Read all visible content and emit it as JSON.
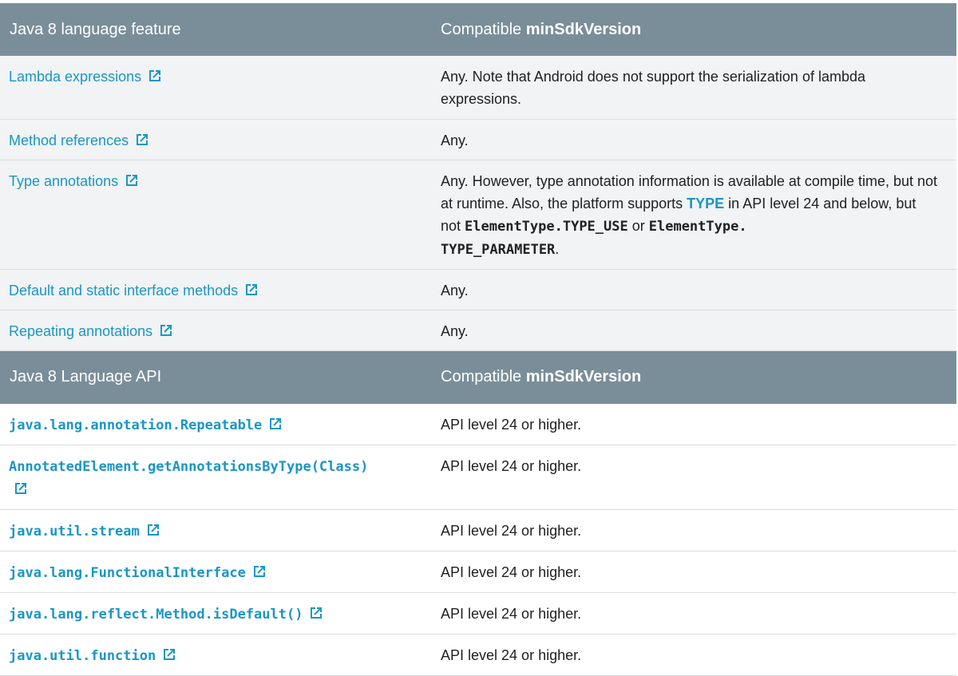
{
  "colors": {
    "header_bg": "#7a8e99",
    "link": "#1a96c4",
    "row_alt_bg": "#f1f3f4",
    "border": "#dadce0"
  },
  "icons": {
    "external_link": "external-link-icon"
  },
  "section1": {
    "header": {
      "col1": "Java 8 language feature",
      "col2_prefix": "Compatible ",
      "col2_bold": "minSdkVersion"
    },
    "rows": [
      {
        "feature": "Lambda expressions",
        "compat": "Any. Note that Android does not support the serialization of lambda expressions."
      },
      {
        "feature": "Method references",
        "compat": "Any."
      },
      {
        "feature": "Type annotations",
        "compat_parts": {
          "p1": "Any. However, type annotation information is available at compile time, but not at runtime. Also, the platform supports ",
          "kw": "TYPE",
          "p2": " in API level 24 and below, but not ",
          "code1": "ElementType.TYPE_USE",
          "p3": " or ",
          "code2a": "ElementType.",
          "code2b": "TYPE_PARAMETER",
          "p4": "."
        }
      },
      {
        "feature": "Default and static interface methods",
        "compat": "Any."
      },
      {
        "feature": "Repeating annotations",
        "compat": "Any."
      }
    ]
  },
  "section2": {
    "header": {
      "col1": "Java 8 Language API",
      "col2_prefix": "Compatible ",
      "col2_bold": "minSdkVersion"
    },
    "rows": [
      {
        "api": "java.lang.annotation.Repeatable",
        "compat": "API level 24 or higher."
      },
      {
        "api": "AnnotatedElement.getAnnotationsByType(Class)",
        "compat": "API level 24 or higher."
      },
      {
        "api": "java.util.stream",
        "compat": "API level 24 or higher."
      },
      {
        "api": "java.lang.FunctionalInterface",
        "compat": "API level 24 or higher."
      },
      {
        "api": "java.lang.reflect.Method.isDefault()",
        "compat": "API level 24 or higher."
      },
      {
        "api": "java.util.function",
        "compat": "API level 24 or higher."
      }
    ]
  }
}
